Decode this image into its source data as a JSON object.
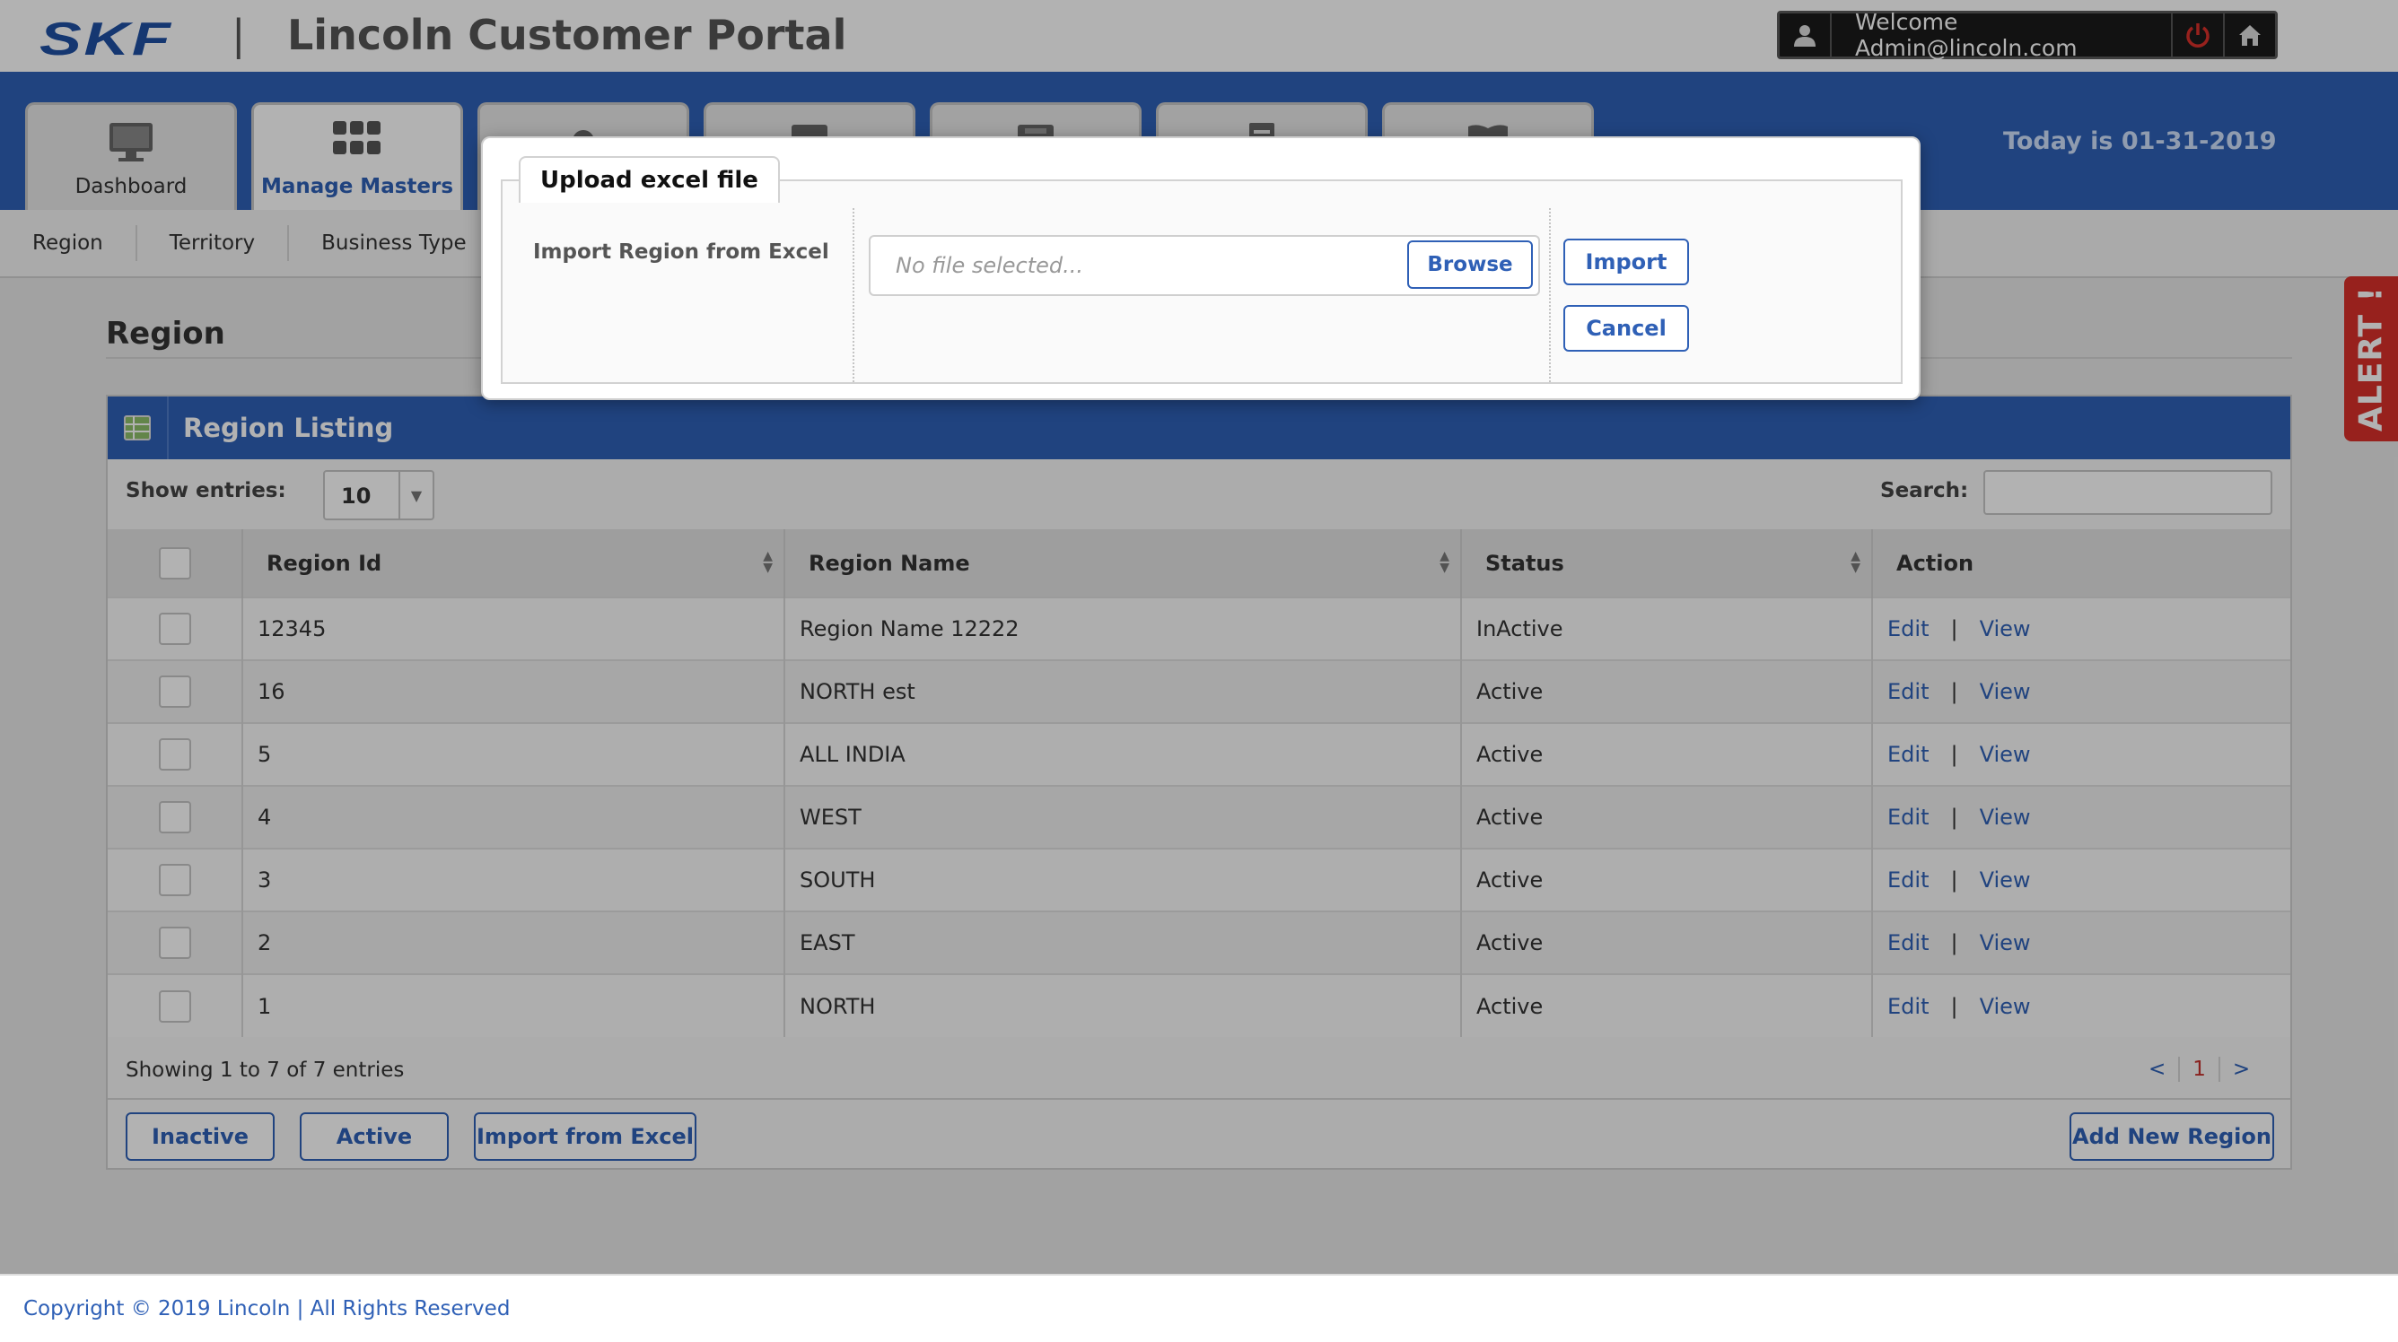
{
  "header": {
    "logo": "SKF",
    "separator": "|",
    "title": "Lincoln Customer Portal",
    "welcome": "Welcome Admin@lincoln.com",
    "icons": [
      "user-icon",
      "power-icon",
      "home-icon"
    ]
  },
  "nav": {
    "tabs": [
      {
        "label": "Dashboard",
        "icon": "monitor-icon",
        "active": false
      },
      {
        "label": "Manage Masters",
        "icon": "grid-icon",
        "active": true
      },
      {
        "label": "",
        "icon": "gear-icon",
        "active": false
      },
      {
        "label": "",
        "icon": "folder-icon",
        "active": false
      },
      {
        "label": "",
        "icon": "printer-icon",
        "active": false
      },
      {
        "label": "",
        "icon": "document-icon",
        "active": false
      },
      {
        "label": "",
        "icon": "book-icon",
        "active": false
      }
    ],
    "today": "Today is 01-31-2019"
  },
  "subnav": {
    "items": [
      "Region",
      "Territory",
      "Business Type"
    ]
  },
  "page": {
    "title": "Region"
  },
  "panel": {
    "title": "Region Listing",
    "show_entries_label": "Show entries:",
    "entries_value": "10",
    "search_label": "Search:",
    "search_value": "",
    "columns": [
      "Region Id",
      "Region Name",
      "Status",
      "Action"
    ],
    "rows": [
      {
        "id": "12345",
        "name": "Region Name 12222",
        "status": "InActive"
      },
      {
        "id": "16",
        "name": "NORTH est",
        "status": "Active"
      },
      {
        "id": "5",
        "name": "ALL INDIA",
        "status": "Active"
      },
      {
        "id": "4",
        "name": "WEST",
        "status": "Active"
      },
      {
        "id": "3",
        "name": "SOUTH",
        "status": "Active"
      },
      {
        "id": "2",
        "name": "EAST",
        "status": "Active"
      },
      {
        "id": "1",
        "name": "NORTH",
        "status": "Active"
      }
    ],
    "action_edit": "Edit",
    "action_sep": "|",
    "action_view": "View",
    "showing": "Showing 1 to 7 of 7 entries",
    "pager": {
      "prev": "<",
      "current": "1",
      "next": ">"
    },
    "buttons": {
      "inactive": "Inactive",
      "active": "Active",
      "import": "Import from Excel",
      "add": "Add New Region"
    }
  },
  "alert_tab": "ALERT !",
  "footer": "Copyright © 2019 Lincoln | All Rights Reserved",
  "modal": {
    "title": "Upload excel file",
    "field_label": "Import Region from Excel",
    "file_placeholder": "No file selected...",
    "browse": "Browse",
    "import": "Import",
    "cancel": "Cancel"
  },
  "colors": {
    "brand_blue": "#2f60b6",
    "active_green": "#3f8f2e",
    "inactive_red": "#c4302b",
    "alert_red": "#d9302a"
  }
}
